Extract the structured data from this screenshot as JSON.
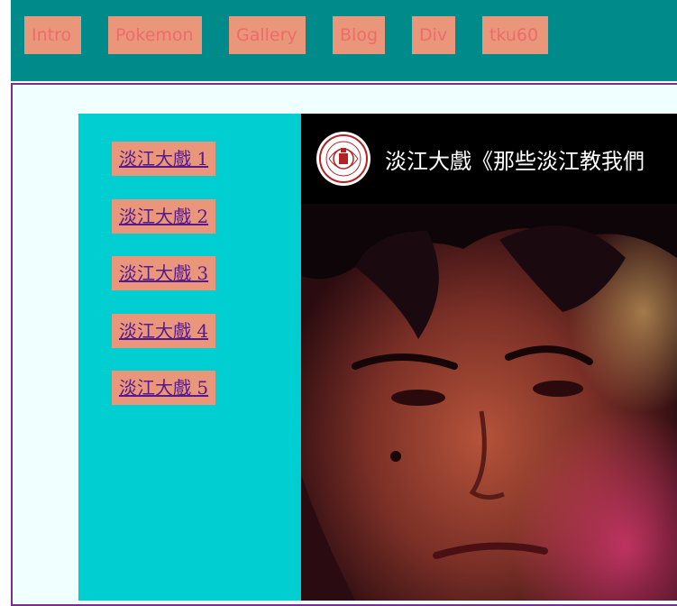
{
  "nav": {
    "items": [
      {
        "label": "Intro"
      },
      {
        "label": "Pokemon"
      },
      {
        "label": "Gallery"
      },
      {
        "label": "Blog"
      },
      {
        "label": "Div"
      },
      {
        "label": "tku60"
      }
    ]
  },
  "sidebar": {
    "links": [
      {
        "label": "淡江大戲 1"
      },
      {
        "label": "淡江大戲 2"
      },
      {
        "label": "淡江大戲 3"
      },
      {
        "label": "淡江大戲 4"
      },
      {
        "label": "淡江大戲 5"
      }
    ]
  },
  "video": {
    "title": "淡江大戲《那些淡江教我們"
  },
  "colors": {
    "topbar": "#008a8a",
    "nav_button": "#e9967a",
    "nav_text": "#ee6b6b",
    "frame_border": "#7b2d8e",
    "content_bg": "#f0ffff",
    "sidebar_bg": "#00ced1",
    "link_text": "#551a8b"
  }
}
